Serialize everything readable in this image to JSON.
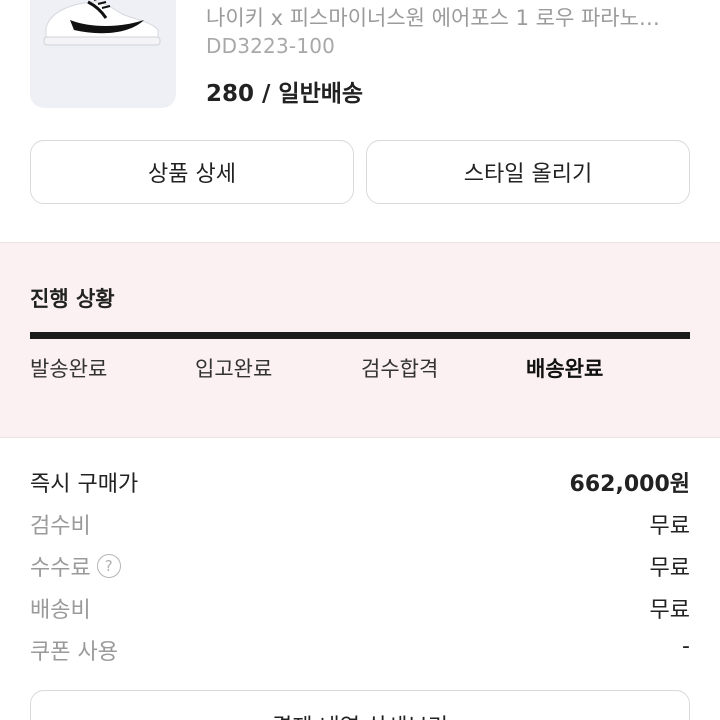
{
  "product": {
    "name": "나이키 x 피스마이너스원 에어포스 1 로우 파라노…",
    "code": "DD3223-100",
    "option": "280 / 일반배송",
    "image_icon": "sneaker-image"
  },
  "buttons": {
    "detail": "상품 상세",
    "style": "스타일 올리기"
  },
  "progress": {
    "title": "진행 상황",
    "steps": [
      "발송완료",
      "입고완료",
      "검수합격",
      "배송완료"
    ],
    "active_step": 3,
    "completion": 1.0
  },
  "price": {
    "rows": [
      {
        "label": "즉시 구매가",
        "value": "662,000원"
      },
      {
        "label": "검수비",
        "value": "무료"
      },
      {
        "label": "수수료",
        "value": "무료",
        "help": "?"
      },
      {
        "label": "배송비",
        "value": "무료"
      },
      {
        "label": "쿠폰 사용",
        "value": "-"
      }
    ]
  },
  "bottom_button": {
    "label": "결제 내역 상세보기"
  }
}
